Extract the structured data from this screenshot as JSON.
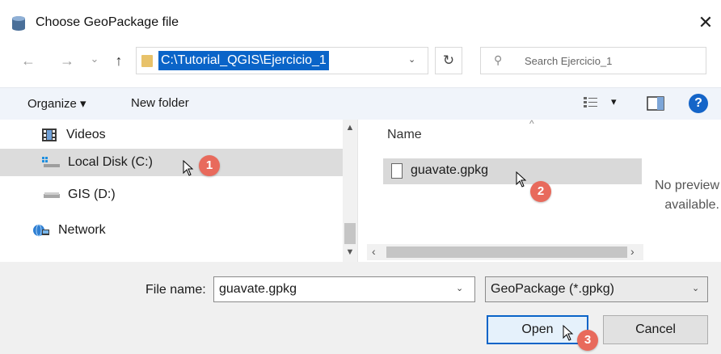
{
  "window": {
    "title": "Choose GeoPackage file",
    "close_glyph": "✕",
    "icon": "database-icon"
  },
  "nav": {
    "back_glyph": "←",
    "forward_glyph": "→",
    "recent_glyph": "⌄",
    "up_glyph": "↑",
    "address": "C:\\Tutorial_QGIS\\Ejercicio_1",
    "address_chevron": "⌄",
    "refresh_glyph": "↻",
    "search_placeholder": "Search Ejercicio_1",
    "search_glyph": "⚲"
  },
  "toolbar": {
    "organize": "Organize ▾",
    "new_folder": "New folder",
    "view_glyph": "▾",
    "help": "?"
  },
  "sidebar": {
    "items": [
      {
        "label": "Videos",
        "icon": "video-folder-icon",
        "selected": false
      },
      {
        "label": "Local Disk (C:)",
        "icon": "windows-drive-icon",
        "selected": true
      },
      {
        "label": "GIS (D:)",
        "icon": "drive-icon",
        "selected": false
      },
      {
        "label": "Network",
        "icon": "network-icon",
        "selected": false
      }
    ]
  },
  "files": {
    "column_name": "Name",
    "sort_glyph": "^",
    "items": [
      {
        "name": "guavate.gpkg",
        "icon": "file-icon",
        "selected": true
      }
    ]
  },
  "preview": {
    "text_line1": "No preview",
    "text_line2": "available."
  },
  "bottom": {
    "file_name_label": "File name:",
    "file_name_value": "guavate.gpkg",
    "file_type_value": "GeoPackage (*.gpkg)",
    "open_label": "Open",
    "cancel_label": "Cancel",
    "combo_glyph": "⌄"
  },
  "annotations": [
    "1",
    "2",
    "3"
  ],
  "colors": {
    "accent": "#0a64c8",
    "selection": "#dcdcdc",
    "badge": "#e86a5c"
  }
}
